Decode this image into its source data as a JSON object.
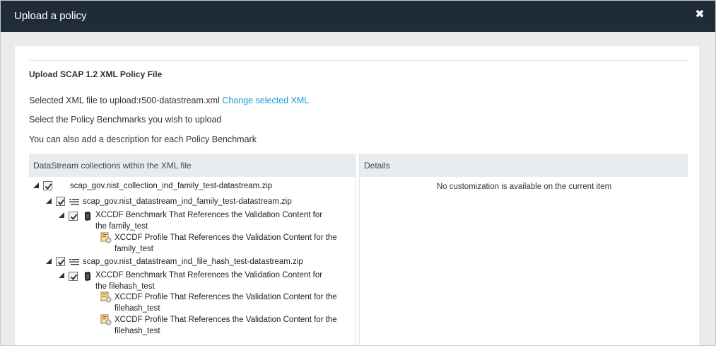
{
  "window": {
    "title": "Upload a policy",
    "close_glyph": "✖"
  },
  "content": {
    "section_title": "Upload SCAP 1.2 XML Policy File",
    "selected_file_prefix": "Selected XML file to upload:r500-datastream.xml",
    "change_link": "Change selected XML",
    "instruction1": "Select the Policy Benchmarks you wish to upload",
    "instruction2": "You can also add a description for each Policy Benchmark"
  },
  "tree": {
    "header": "DataStream collections within the XML file",
    "nodes": [
      {
        "label": "scap_gov.nist_collection_ind_family_test-datastream.zip",
        "checked": true,
        "expanded": true,
        "icon": "none"
      },
      {
        "label": "scap_gov.nist_datastream_ind_family_test-datastream.zip",
        "checked": true,
        "expanded": true,
        "icon": "datastream-icon"
      },
      {
        "label": "XCCDF Benchmark That References the Validation Content for the family_test",
        "checked": true,
        "expanded": true,
        "icon": "benchmark-icon"
      },
      {
        "label": "XCCDF Profile That References the Validation Content for the family_test",
        "icon": "profile-icon"
      },
      {
        "label": "scap_gov.nist_datastream_ind_file_hash_test-datastream.zip",
        "checked": true,
        "expanded": true,
        "icon": "datastream-icon"
      },
      {
        "label": "XCCDF Benchmark That References the Validation Content for the filehash_test",
        "checked": true,
        "expanded": true,
        "icon": "benchmark-icon"
      },
      {
        "label": "XCCDF Profile That References the Validation Content for the filehash_test",
        "icon": "profile-icon"
      },
      {
        "label": "XCCDF Profile That References the Validation Content for the filehash_test",
        "icon": "profile-icon"
      }
    ]
  },
  "details": {
    "header": "Details",
    "empty_text": "No customization is available on the current item"
  },
  "colors": {
    "titlebar": "#1f2b37",
    "link": "#1a9bd7",
    "header_bg": "#e9ecef"
  }
}
